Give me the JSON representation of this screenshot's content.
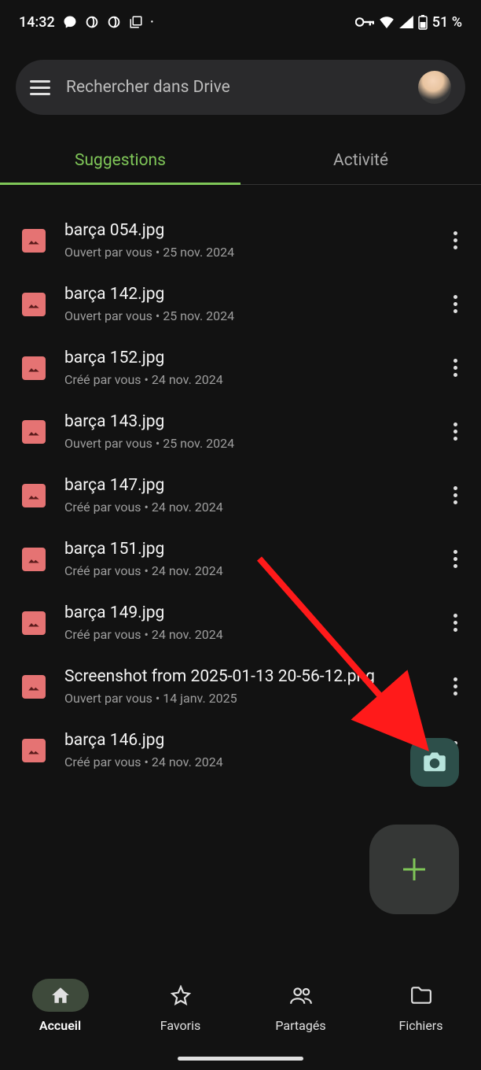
{
  "status_bar": {
    "time": "14:32",
    "battery": "51 %"
  },
  "search": {
    "placeholder": "Rechercher dans Drive"
  },
  "tabs": {
    "suggestions": "Suggestions",
    "activity": "Activité"
  },
  "files": [
    {
      "name": "barça 054.jpg",
      "meta": "Ouvert par vous • 25 nov. 2024"
    },
    {
      "name": "barça 142.jpg",
      "meta": "Ouvert par vous • 25 nov. 2024"
    },
    {
      "name": "barça 152.jpg",
      "meta": "Créé par vous • 24 nov. 2024"
    },
    {
      "name": "barça 143.jpg",
      "meta": "Ouvert par vous • 25 nov. 2024"
    },
    {
      "name": "barça 147.jpg",
      "meta": "Créé par vous • 24 nov. 2024"
    },
    {
      "name": "barça 151.jpg",
      "meta": "Créé par vous • 24 nov. 2024"
    },
    {
      "name": "barça 149.jpg",
      "meta": "Créé par vous • 24 nov. 2024"
    },
    {
      "name": "Screenshot from 2025-01-13 20-56-12.png",
      "meta": "Ouvert par vous • 14 janv. 2025"
    },
    {
      "name": "barça 146.jpg",
      "meta": "Créé par vous • 24 nov. 2024"
    }
  ],
  "nav": {
    "home": "Accueil",
    "favorites": "Favoris",
    "shared": "Partagés",
    "files": "Fichiers"
  }
}
